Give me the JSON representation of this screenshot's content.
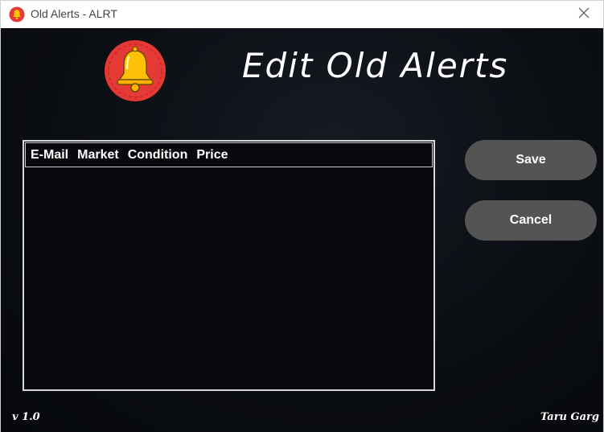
{
  "window": {
    "title": "Old Alerts - ALRT",
    "app_icon": "bell-icon",
    "close_icon": "close-icon"
  },
  "header": {
    "logo_icon": "bell-icon",
    "heading": "Edit Old Alerts"
  },
  "alerts_table": {
    "columns": [
      "E-Mail",
      "Market",
      "Condition",
      "Price"
    ],
    "rows": []
  },
  "actions": {
    "save_label": "Save",
    "cancel_label": "Cancel"
  },
  "footer": {
    "version": "v 1.0",
    "author": "Taru Garg"
  },
  "colors": {
    "background": "#0b0e13",
    "button": "#545454",
    "bell_red": "#e53935",
    "bell_yellow": "#ffc107"
  }
}
